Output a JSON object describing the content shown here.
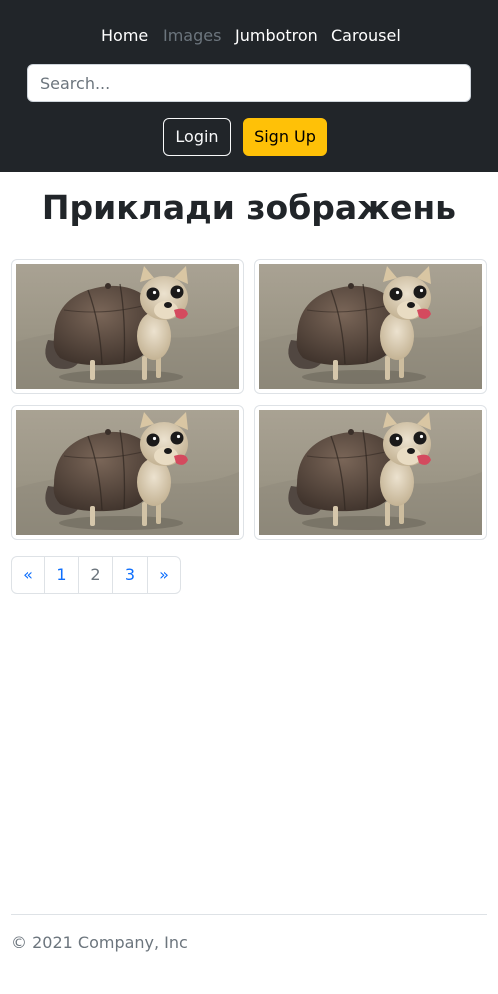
{
  "header": {
    "nav": [
      {
        "label": "Home",
        "active": false
      },
      {
        "label": "Images",
        "active": true
      },
      {
        "label": "Jumbotron",
        "active": false
      },
      {
        "label": "Carousel",
        "active": false
      }
    ],
    "search": {
      "value": "",
      "placeholder": "Search..."
    },
    "login_label": "Login",
    "signup_label": "Sign Up"
  },
  "main": {
    "title": "Приклади зображень",
    "images": [
      {
        "subject": "chihuahua wearing a cap"
      },
      {
        "subject": "chihuahua wearing a cap"
      },
      {
        "subject": "chihuahua wearing a cap"
      },
      {
        "subject": "chihuahua wearing a cap"
      }
    ],
    "pagination": {
      "prev": "«",
      "pages": [
        "1",
        "2",
        "3"
      ],
      "current": "2",
      "next": "»"
    }
  },
  "footer": {
    "text": "© 2021 Company, Inc"
  },
  "colors": {
    "header_bg": "#212529",
    "signup_bg": "#ffc107",
    "link": "#0d6efd",
    "muted": "#6c757d"
  }
}
